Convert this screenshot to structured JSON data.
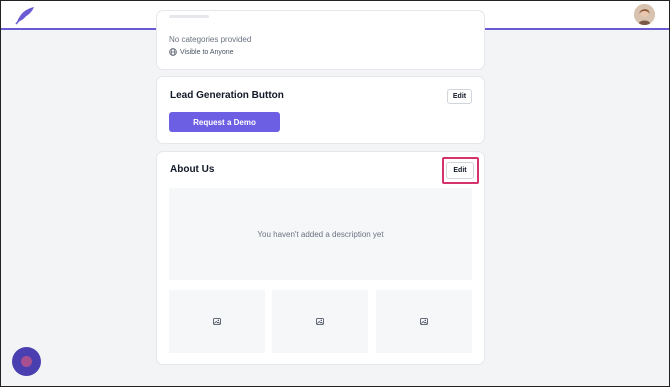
{
  "colors": {
    "brand": "#6b5bd2",
    "button": "#6d5fe3",
    "highlight": "#d6336c"
  },
  "header": {
    "logo_icon": "feather-logo-icon",
    "avatar_icon": "user-avatar"
  },
  "categories_card": {
    "empty_text": "No categories provided",
    "visibility_icon": "globe-icon",
    "visibility_text": "Visible to Anyone"
  },
  "lead_card": {
    "title": "Lead Generation Button",
    "edit_label": "Edit",
    "button_label": "Request a Demo"
  },
  "about_card": {
    "title": "About Us",
    "edit_label": "Edit",
    "empty_description": "You haven't added a description yet",
    "image_icon": "image-placeholder-icon"
  },
  "fab": {
    "icon": "chat-bubble-icon"
  }
}
